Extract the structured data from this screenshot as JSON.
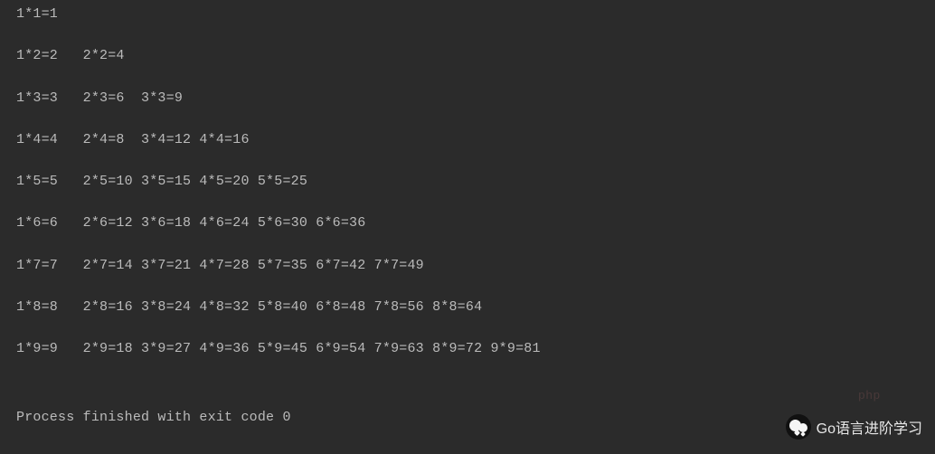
{
  "table": [
    [
      [
        1,
        1,
        1
      ]
    ],
    [
      [
        1,
        2,
        2
      ],
      [
        2,
        2,
        4
      ]
    ],
    [
      [
        1,
        3,
        3
      ],
      [
        2,
        3,
        6
      ],
      [
        3,
        3,
        9
      ]
    ],
    [
      [
        1,
        4,
        4
      ],
      [
        2,
        4,
        8
      ],
      [
        3,
        4,
        12
      ],
      [
        4,
        4,
        16
      ]
    ],
    [
      [
        1,
        5,
        5
      ],
      [
        2,
        5,
        10
      ],
      [
        3,
        5,
        15
      ],
      [
        4,
        5,
        20
      ],
      [
        5,
        5,
        25
      ]
    ],
    [
      [
        1,
        6,
        6
      ],
      [
        2,
        6,
        12
      ],
      [
        3,
        6,
        18
      ],
      [
        4,
        6,
        24
      ],
      [
        5,
        6,
        30
      ],
      [
        6,
        6,
        36
      ]
    ],
    [
      [
        1,
        7,
        7
      ],
      [
        2,
        7,
        14
      ],
      [
        3,
        7,
        21
      ],
      [
        4,
        7,
        28
      ],
      [
        5,
        7,
        35
      ],
      [
        6,
        7,
        42
      ],
      [
        7,
        7,
        49
      ]
    ],
    [
      [
        1,
        8,
        8
      ],
      [
        2,
        8,
        16
      ],
      [
        3,
        8,
        24
      ],
      [
        4,
        8,
        32
      ],
      [
        5,
        8,
        40
      ],
      [
        6,
        8,
        48
      ],
      [
        7,
        8,
        56
      ],
      [
        8,
        8,
        64
      ]
    ],
    [
      [
        1,
        9,
        9
      ],
      [
        2,
        9,
        18
      ],
      [
        3,
        9,
        27
      ],
      [
        4,
        9,
        36
      ],
      [
        5,
        9,
        45
      ],
      [
        6,
        9,
        54
      ],
      [
        7,
        9,
        63
      ],
      [
        8,
        9,
        72
      ],
      [
        9,
        9,
        81
      ]
    ]
  ],
  "process": {
    "text": "Process finished with exit code 0"
  },
  "badge": {
    "text": "Go语言进阶学习"
  },
  "watermark": {
    "text": "php"
  }
}
